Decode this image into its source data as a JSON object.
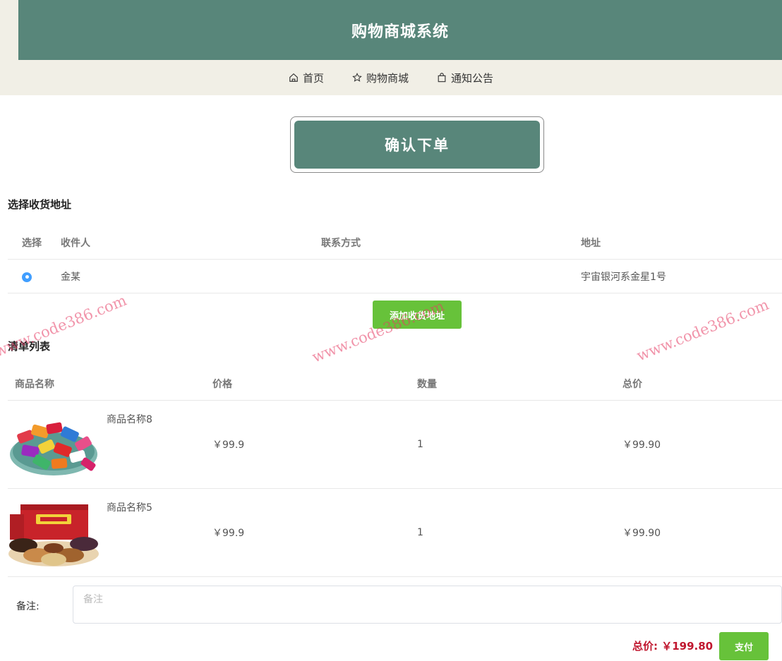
{
  "header": {
    "title": "购物商城系统"
  },
  "nav": [
    {
      "label": "首页",
      "icon": "home-icon"
    },
    {
      "label": "购物商城",
      "icon": "star-icon"
    },
    {
      "label": "通知公告",
      "icon": "bag-icon"
    }
  ],
  "page": {
    "heading": "确认下单"
  },
  "address": {
    "section_title": "选择收货地址",
    "columns": [
      "选择",
      "收件人",
      "联系方式",
      "地址"
    ],
    "rows": [
      {
        "selected": true,
        "name": "金某",
        "phone": "",
        "address": "宇宙银河系金星1号"
      }
    ],
    "add_button": "添加收货地址"
  },
  "cart": {
    "section_title": "清单列表",
    "columns": [
      "商品名称",
      "价格",
      "数量",
      "总价"
    ],
    "items": [
      {
        "name": "商品名称8",
        "price": "￥99.9",
        "qty": "1",
        "total": "￥99.90",
        "image": "candy-platter-image"
      },
      {
        "name": "商品名称5",
        "price": "￥99.9",
        "qty": "1",
        "total": "￥99.90",
        "image": "nut-gift-box-image"
      }
    ]
  },
  "remark": {
    "label": "备注:",
    "placeholder": "备注",
    "value": ""
  },
  "summary": {
    "total_label": "总价:",
    "total_value": "￥199.80",
    "pay_button": "支付"
  },
  "watermark": "www.code386.com",
  "colors": {
    "primary": "#58867a",
    "band": "#f1efe6",
    "success": "#67c23a",
    "price_red": "#c0172f",
    "radio": "#409eff"
  }
}
